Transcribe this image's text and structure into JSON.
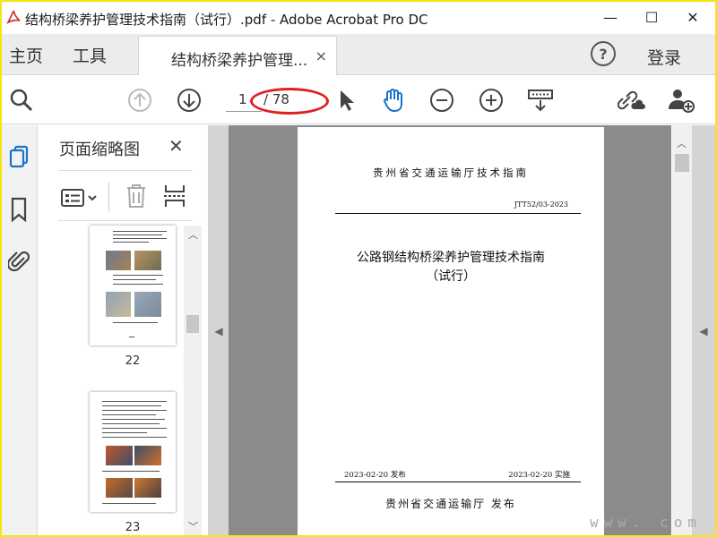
{
  "window": {
    "title": "结构桥梁养护管理技术指南（试行）.pdf - Adobe Acrobat Pro DC",
    "minimize": "—",
    "maximize": "☐",
    "close": "✕"
  },
  "tabs": {
    "home": "主页",
    "tools": "工具",
    "document": "结构桥梁养护管理...",
    "document_close": "×",
    "help": "?",
    "login": "登录"
  },
  "toolbar": {
    "current_page": "1",
    "total_pages": "/ 78"
  },
  "panel": {
    "title": "页面缩略图",
    "close": "✕",
    "thumbnails": [
      {
        "label": "22"
      },
      {
        "label": "23"
      }
    ]
  },
  "page": {
    "header": "贵州省交通运输厅技术指南",
    "code": "JTT52/03-2023",
    "title": "公路钢结构桥梁养护管理技术指南",
    "subtitle": "（试行）",
    "publish_date": "2023-02-20  发布",
    "effective_date": "2023-02-20  实施",
    "issuer": "贵州省交通运输厅   发布"
  },
  "watermark": "www.   com",
  "colors": {
    "frame_border": "#f5e60f",
    "annotation": "#e02020",
    "accent_icon": "#1a73c8"
  },
  "icons": [
    "acrobat-logo-icon",
    "search-icon",
    "page-up-icon",
    "page-down-icon",
    "select-arrow-icon",
    "hand-tool-icon",
    "zoom-out-icon",
    "zoom-in-icon",
    "page-display-icon",
    "share-link-icon",
    "add-user-icon",
    "pages-icon",
    "bookmark-icon",
    "attachment-icon",
    "thumbnail-options-icon",
    "delete-icon",
    "extract-icon"
  ]
}
